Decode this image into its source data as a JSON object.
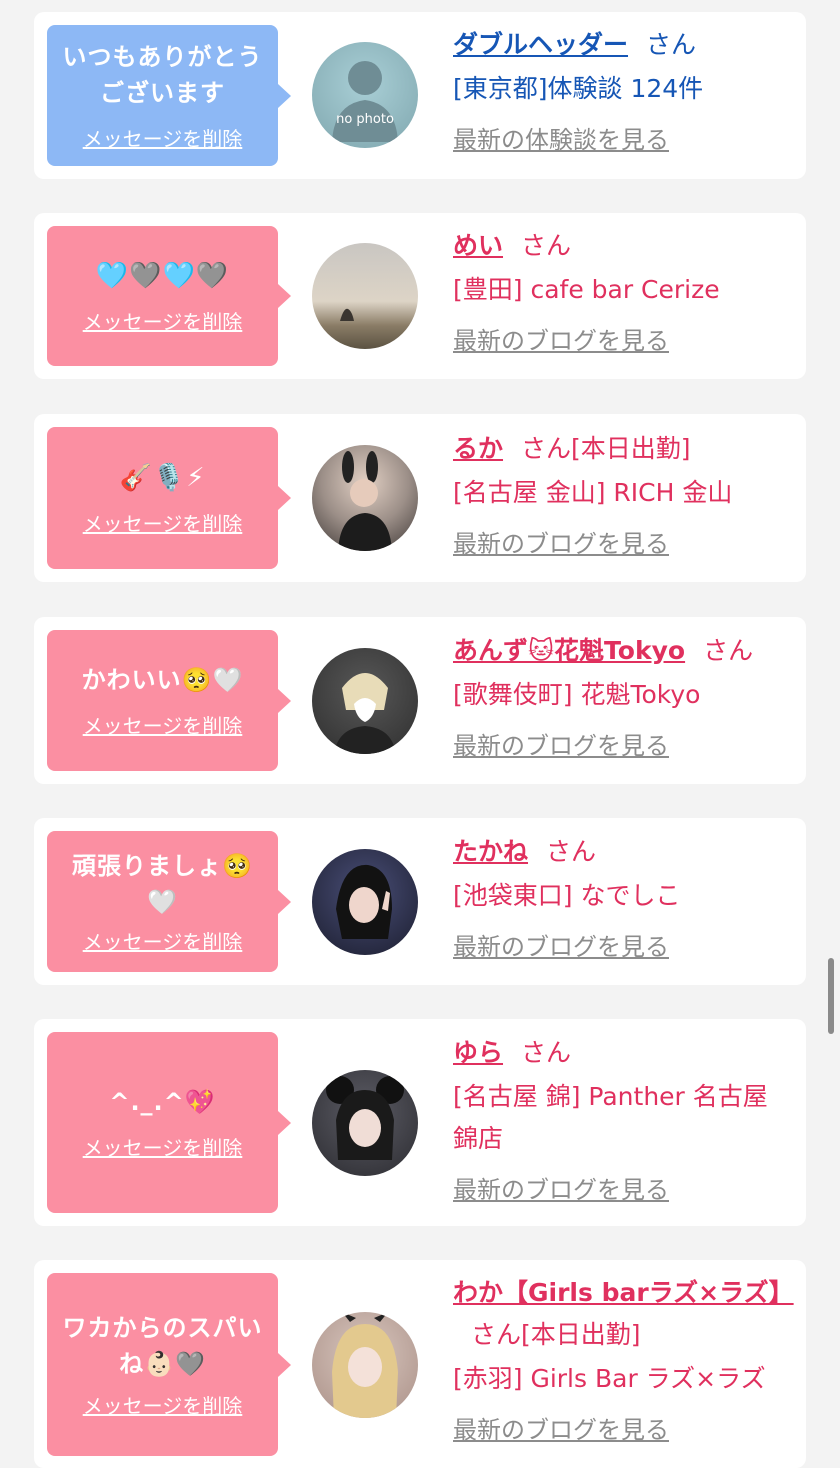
{
  "colors": {
    "blue_bubble": "#8db8f5",
    "pink_bubble": "#fb8fa2",
    "blue_text": "#1656b5",
    "pink_text": "#e0305e"
  },
  "delete_label": "メッセージを削除",
  "cards": [
    {
      "message": "いつもありがとうございます",
      "name": "ダブルヘッダー",
      "san": "さん",
      "shop": "[東京都]体験談 124件",
      "more": "最新の体験談を見る",
      "avatar_text": "no photo"
    },
    {
      "message": "🩵🩶🩵🩶",
      "name": "めい",
      "san": "さん",
      "shop": "[豊田] cafe bar Cerize",
      "more": "最新のブログを見る"
    },
    {
      "message": "🎸🎙️⚡",
      "name": "るか",
      "san": "さん[本日出勤]",
      "shop": "[名古屋 金山] RICH 金山",
      "more": "最新のブログを見る"
    },
    {
      "message": "かわいい🥺🤍",
      "name": "あんず🐱花魁Tokyo",
      "san": "さん",
      "shop": "[歌舞伎町] 花魁Tokyo",
      "more": "最新のブログを見る"
    },
    {
      "message": "頑張りましょ🥺🤍",
      "name": "たかね",
      "san": "さん",
      "shop": "[池袋東口] なでしこ",
      "more": "最新のブログを見る"
    },
    {
      "message": "^._.^💖",
      "name": "ゆら",
      "san": "さん",
      "shop": "[名古屋 錦] Panther 名古屋錦店",
      "more": "最新のブログを見る"
    },
    {
      "message": "ワカからのスパいね👶🏻🩶",
      "name": "わか【Girls barラズ×ラズ】",
      "san": "さん[本日出勤]",
      "shop": "[赤羽] Girls Bar ラズ×ラズ",
      "more": "最新のブログを見る"
    }
  ]
}
